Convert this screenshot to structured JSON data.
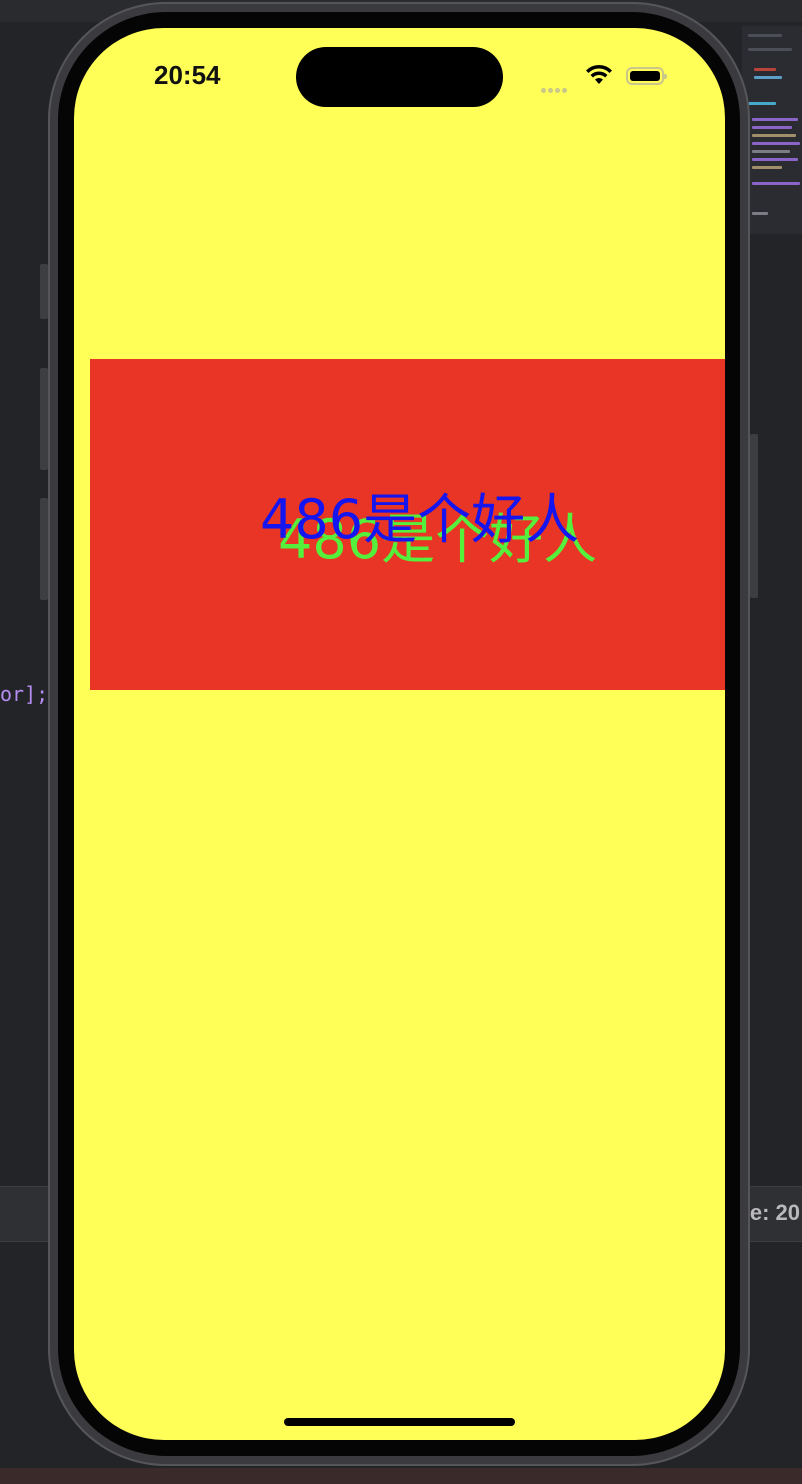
{
  "editor": {
    "code_fragment": "or];",
    "status_text": "e: 20"
  },
  "status_bar": {
    "time": "20:54",
    "icons": [
      "signal-icon",
      "wifi-icon",
      "battery-icon"
    ]
  },
  "content": {
    "label_back": "486是个好人",
    "label_front": "486是个好人"
  },
  "colors": {
    "screen_background": "#ffff57",
    "red_view": "#e83525",
    "label_back_color": "#55f03c",
    "label_front_color": "#1515f0"
  }
}
